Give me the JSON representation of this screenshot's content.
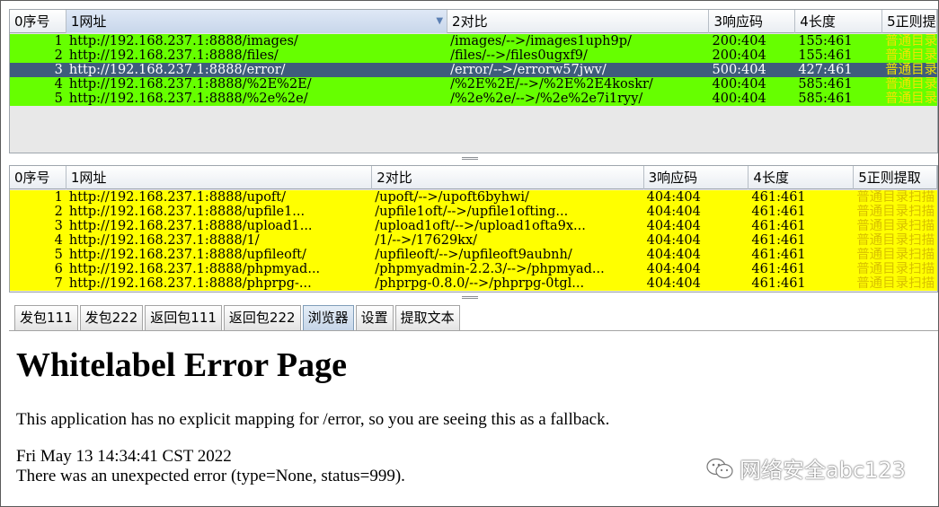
{
  "top_table": {
    "columns": [
      "0序号",
      "1网址",
      "2对比",
      "3响应码",
      "4长度",
      "5正则提"
    ],
    "rows": [
      {
        "n": "1",
        "url": "http://192.168.237.1:8888/images/",
        "cmp": "/images/-->/images1uph9p/",
        "code": "200:404",
        "len": "155:461",
        "re": "普通目录扫"
      },
      {
        "n": "2",
        "url": "http://192.168.237.1:8888/files/",
        "cmp": "/files/-->/files0ugxf9/",
        "code": "200:404",
        "len": "155:461",
        "re": "普通目录扫"
      },
      {
        "n": "3",
        "url": "http://192.168.237.1:8888/error/",
        "cmp": "/error/-->/errorw57jwv/",
        "code": "500:404",
        "len": "427:461",
        "re": "普通目录扫"
      },
      {
        "n": "4",
        "url": "http://192.168.237.1:8888/%2E%2E/",
        "cmp": "/%2E%2E/-->/%2E%2E4koskr/",
        "code": "400:404",
        "len": "585:461",
        "re": "普通目录扫"
      },
      {
        "n": "5",
        "url": "http://192.168.237.1:8888/%2e%2e/",
        "cmp": "/%2e%2e/-->/%2e%2e7i1ryy/",
        "code": "400:404",
        "len": "585:461",
        "re": "普通目录扫"
      }
    ]
  },
  "bottom_table": {
    "columns": [
      "0序号",
      "1网址",
      "2对比",
      "3响应码",
      "4长度",
      "5正则提取"
    ],
    "rows": [
      {
        "n": "1",
        "url": "http://192.168.237.1:8888/upoft/",
        "cmp": "/upoft/-->/upoft6byhwi/",
        "code": "404:404",
        "len": "461:461",
        "re": "普通目录扫描"
      },
      {
        "n": "2",
        "url": "http://192.168.237.1:8888/upfile1...",
        "cmp": "/upfile1oft/-->/upfile1ofting...",
        "code": "404:404",
        "len": "461:461",
        "re": "普通目录扫描"
      },
      {
        "n": "3",
        "url": "http://192.168.237.1:8888/upload1...",
        "cmp": "/upload1oft/-->/upload1ofta9x...",
        "code": "404:404",
        "len": "461:461",
        "re": "普通目录扫描"
      },
      {
        "n": "4",
        "url": "http://192.168.237.1:8888/1/",
        "cmp": "/1/-->/17629kx/",
        "code": "404:404",
        "len": "461:461",
        "re": "普通目录扫描"
      },
      {
        "n": "5",
        "url": "http://192.168.237.1:8888/upfileoft/",
        "cmp": "/upfileoft/-->/upfileoft9aubnh/",
        "code": "404:404",
        "len": "461:461",
        "re": "普通目录扫描"
      },
      {
        "n": "6",
        "url": "http://192.168.237.1:8888/phpmyad...",
        "cmp": "/phpmyadmin-2.2.3/-->/phpmyad...",
        "code": "404:404",
        "len": "461:461",
        "re": "普通目录扫描"
      },
      {
        "n": "7",
        "url": "http://192.168.237.1:8888/phprpg-...",
        "cmp": "/phprpg-0.8.0/-->/phprpg-0tgl...",
        "code": "404:404",
        "len": "461:461",
        "re": "普通目录扫描"
      }
    ]
  },
  "tabs": [
    "发包111",
    "发包222",
    "返回包111",
    "返回包222",
    "浏览器",
    "设置",
    "提取文本"
  ],
  "browser": {
    "title": "Whitelabel Error Page",
    "line1": "This application has no explicit mapping for /error, so you are seeing this as a fallback.",
    "line2": "Fri May 13 14:34:41 CST 2022",
    "line3": "There was an unexpected error (type=None, status=999)."
  },
  "watermark": "网络安全abc123",
  "colors": {
    "row_green": "#66ff00",
    "row_yellow": "#ffff00",
    "row_selected": "#3f5c7c"
  }
}
